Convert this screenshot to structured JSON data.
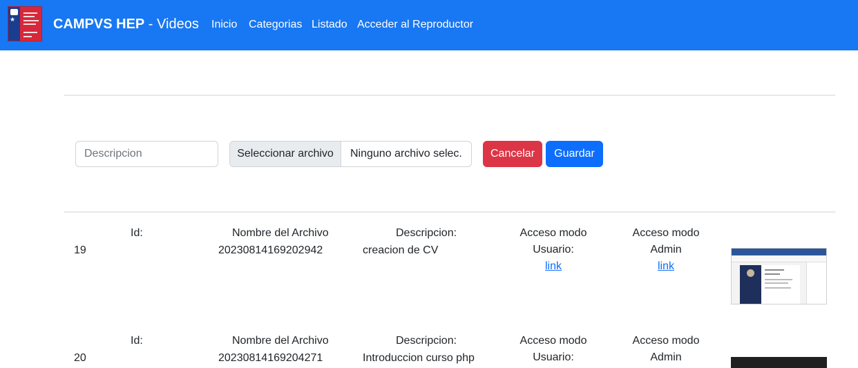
{
  "navbar": {
    "brand_bold": "CAMPVS HEP",
    "brand_rest": " - Videos",
    "links": [
      "Inicio",
      "Categorias",
      "Listado",
      "Acceder al Reproductor"
    ],
    "color": "#1877f2"
  },
  "form": {
    "description_placeholder": "Descripcion",
    "file_button_label": "Seleccionar archivo",
    "file_name_text": "Ninguno archivo selec.",
    "cancel_label": "Cancelar",
    "save_label": "Guardar",
    "cancel_color": "#dc3545",
    "save_color": "#0d6efd"
  },
  "labels": {
    "id": "Id:",
    "file_name": "Nombre del Archivo",
    "description": "Descripcion:",
    "user_access_1": "Acceso modo",
    "user_access_2": "Usuario:",
    "admin_access_1": "Acceso modo",
    "admin_access_2": "Admin",
    "link": "link"
  },
  "rows": [
    {
      "id": "19",
      "file_name": "20230814169202942",
      "description": "creacion de CV",
      "thumbnail": "cv-editor-screenshot"
    },
    {
      "id": "20",
      "file_name": "20230814169204271",
      "description": "Introduccion curso php",
      "thumbnail": "dark-video-frame"
    }
  ]
}
